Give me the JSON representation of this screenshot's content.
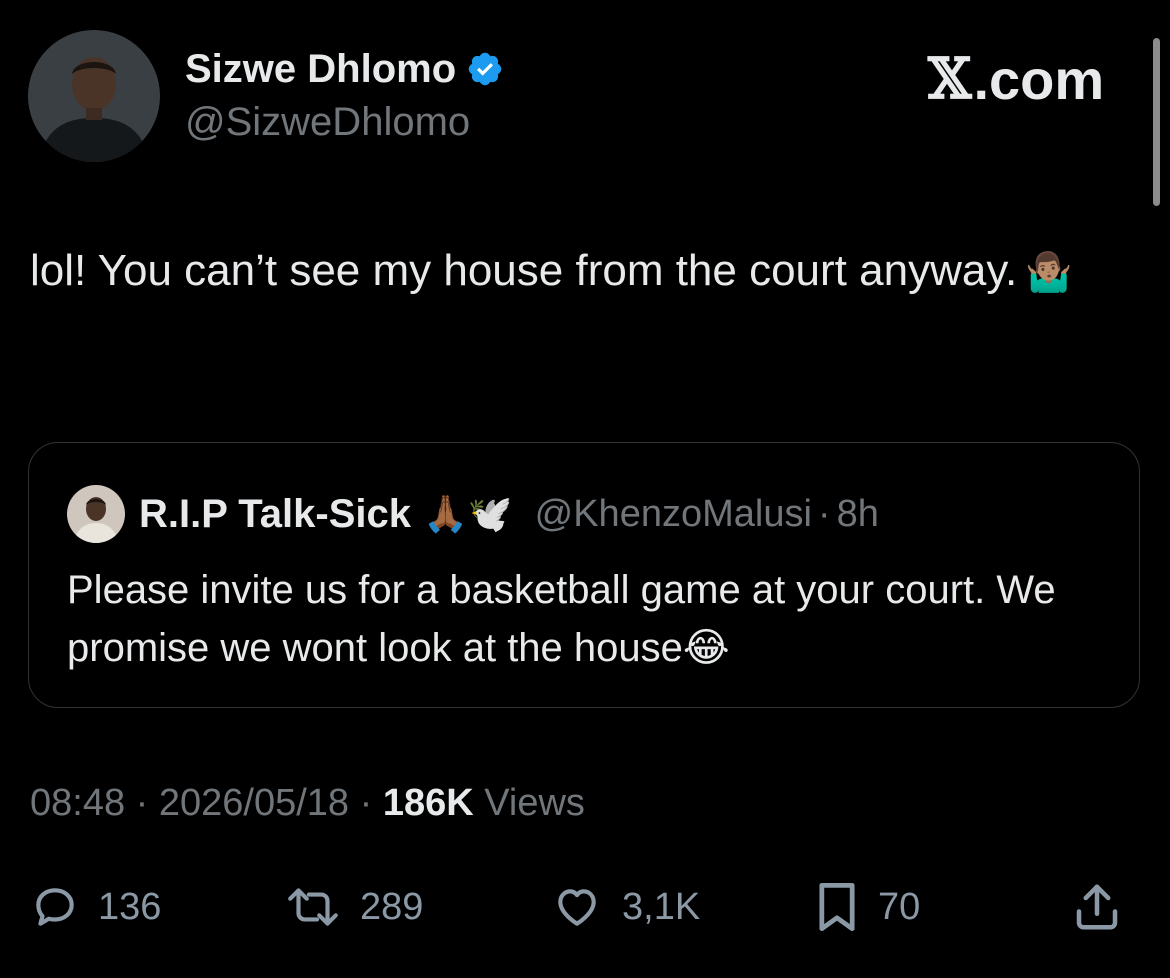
{
  "author": {
    "display_name": "Sizwe Dhlomo",
    "handle": "@SizweDhlomo",
    "verified": true,
    "avatar_icon": "profile-photo"
  },
  "brand": {
    "mark": "𝕏",
    "suffix": ".com"
  },
  "tweet": {
    "text": "lol! You can’t see my house from the court anyway.",
    "emoji": "🤷🏽‍♂️"
  },
  "quote": {
    "display_name": "R.I.P Talk-Sick",
    "name_emojis": "🙏🏾🕊️",
    "handle": "@KhenzoMalusi",
    "separator": "·",
    "time": "8h",
    "text": "Please invite us for a basketball game at your court. We promise we wont look at the house😂"
  },
  "meta": {
    "time": "08:48",
    "sep1": " · ",
    "date": "2026/05/18",
    "sep2": " · ",
    "views_count": "186K",
    "views_label": " Views"
  },
  "actions": {
    "replies": "136",
    "retweets": "289",
    "likes": "3,1K",
    "bookmarks": "70"
  },
  "colors": {
    "background": "#000000",
    "text_primary": "#e7e9ea",
    "text_secondary": "#71767b",
    "verified_badge": "#1d9bf0",
    "border": "#2f3336"
  }
}
